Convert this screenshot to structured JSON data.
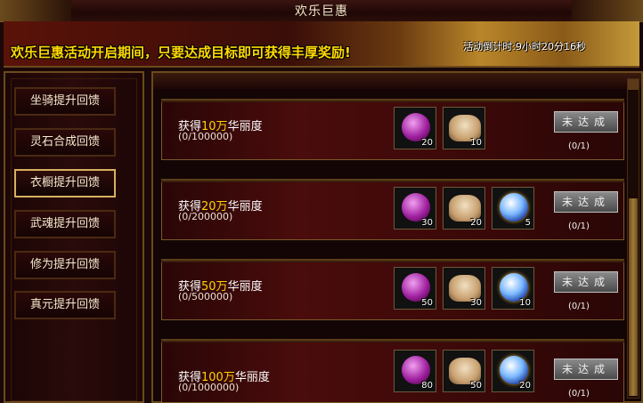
{
  "window": {
    "title": "欢乐巨惠"
  },
  "banner": {
    "message": "欢乐巨惠活动开启期间，只要达成目标即可获得丰厚奖励!",
    "countdown_label": "活动倒计时:",
    "countdown_value": "9小时20分16秒"
  },
  "sidebar": {
    "items": [
      {
        "label": "坐骑提升回馈",
        "active": false
      },
      {
        "label": "灵石合成回馈",
        "active": false
      },
      {
        "label": "衣橱提升回馈",
        "active": true
      },
      {
        "label": "武魂提升回馈",
        "active": false
      },
      {
        "label": "修为提升回馈",
        "active": false
      },
      {
        "label": "真元提升回馈",
        "active": false
      }
    ]
  },
  "rewards": [
    {
      "prefix": "获得",
      "amount": "10万",
      "suffix": "华丽度",
      "progress": "(0/100000)",
      "items": [
        {
          "icon": "purple-gem-icon",
          "qty": "20"
        },
        {
          "icon": "gift-bag-icon",
          "qty": "10"
        }
      ],
      "status": "未达成",
      "count": "(0/1)"
    },
    {
      "prefix": "获得",
      "amount": "20万",
      "suffix": "华丽度",
      "progress": "(0/200000)",
      "items": [
        {
          "icon": "purple-gem-icon",
          "qty": "30"
        },
        {
          "icon": "gift-bag-icon",
          "qty": "20"
        },
        {
          "icon": "blue-orb-icon",
          "qty": "5"
        }
      ],
      "status": "未达成",
      "count": "(0/1)"
    },
    {
      "prefix": "获得",
      "amount": "50万",
      "suffix": "华丽度",
      "progress": "(0/500000)",
      "items": [
        {
          "icon": "purple-gem-icon",
          "qty": "50"
        },
        {
          "icon": "gift-bag-icon",
          "qty": "30"
        },
        {
          "icon": "blue-orb-icon",
          "qty": "10"
        }
      ],
      "status": "未达成",
      "count": "(0/1)"
    },
    {
      "prefix": "获得",
      "amount": "100万",
      "suffix": "华丽度",
      "progress": "(0/1000000)",
      "items": [
        {
          "icon": "purple-gem-icon",
          "qty": "80"
        },
        {
          "icon": "gift-bag-icon",
          "qty": "50"
        },
        {
          "icon": "blue-orb-icon",
          "qty": "20"
        }
      ],
      "status": "未达成",
      "count": "(0/1)"
    }
  ],
  "colors": {
    "accent_gold": "#ffd200",
    "banner_text": "#ffd900",
    "active_border": "#d8b060"
  }
}
